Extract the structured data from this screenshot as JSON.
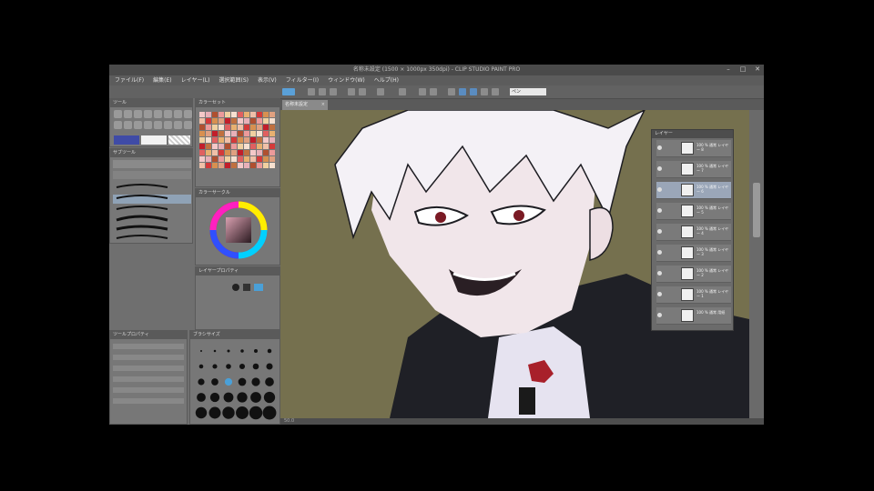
{
  "app": {
    "title": "名称未設定 (1500 × 1000px 350dpi) - CLIP STUDIO PAINT PRO",
    "window_buttons": [
      "–",
      "□",
      "✕"
    ]
  },
  "menubar": {
    "items": [
      "ファイル(F)",
      "編集(E)",
      "レイヤー(L)",
      "選択範囲(S)",
      "表示(V)",
      "フィルター(I)",
      "ウィンドウ(W)",
      "ヘルプ(H)"
    ]
  },
  "cmdbar": {
    "subtool_value": "ペン"
  },
  "canvas_tab": {
    "label": "名称未設定",
    "close": "×"
  },
  "panels": {
    "tool_header": "ツール",
    "subtool_header": "サブツール",
    "color_set_header": "カラーセット",
    "color_wheel_header": "カラーサークル",
    "brush_size_header": "ブラシサイズ",
    "layer_property_header": "レイヤープロパティ",
    "tool_property_header": "ツールプロパティ"
  },
  "layers": {
    "header": "レイヤー",
    "rows": [
      {
        "name": "100 % 通常 レイヤー 8",
        "selected": false
      },
      {
        "name": "100 % 通常 レイヤー 7",
        "selected": false
      },
      {
        "name": "100 % 通常 レイヤー 6",
        "selected": true
      },
      {
        "name": "100 % 通常 レイヤー 5",
        "selected": false
      },
      {
        "name": "100 % 通常 レイヤー 4",
        "selected": false
      },
      {
        "name": "100 % 通常 レイヤー 3",
        "selected": false
      },
      {
        "name": "100 % 通常 レイヤー 2",
        "selected": false
      },
      {
        "name": "100 % 通常 レイヤー 1",
        "selected": false
      },
      {
        "name": "100 % 通常 用紙",
        "selected": false
      }
    ]
  },
  "status": {
    "zoom": "50.0"
  },
  "colors": {
    "canvas_bg": "#75704e",
    "ui_dark": "#4a4a4a",
    "ui_mid": "#6e6e6e",
    "accent_selected": "#9aa6b8"
  }
}
